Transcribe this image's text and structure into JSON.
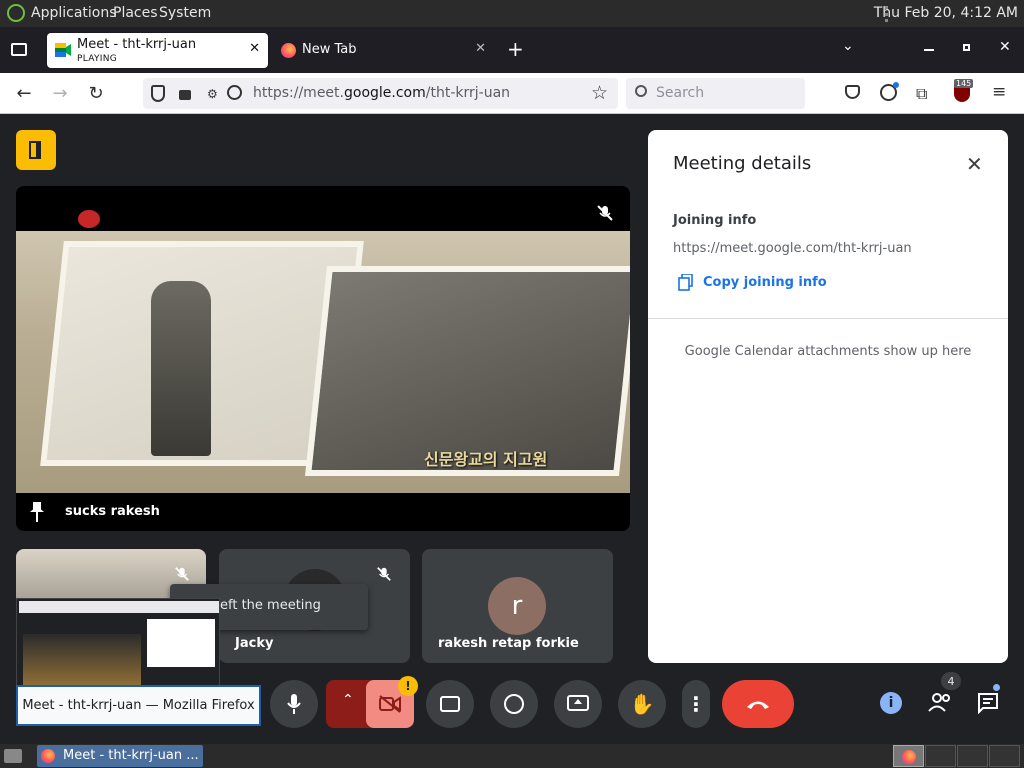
{
  "top_panel": {
    "applications": "Applications",
    "places": "Places",
    "system": "System",
    "clock": "Thu Feb 20,  4:12 AM"
  },
  "tabs": [
    {
      "title": "Meet - tht-krrj-uan",
      "subtitle": "PLAYING"
    },
    {
      "title": "New Tab"
    }
  ],
  "navbar": {
    "url_prefix": "https://meet.",
    "url_domain": "google.com",
    "url_path": "/tht-krrj-uan",
    "search_placeholder": "Search",
    "extension_badge": "145"
  },
  "main_tile": {
    "name": "sucks rakesh",
    "subtitle_overlay": "신문왕교의 지고원"
  },
  "tiles": [
    {
      "name": ""
    },
    {
      "name": "Jacky"
    },
    {
      "name": "rakesh retap forkie",
      "avatar_letter": "r",
      "avatar_color": "#8d6e63"
    }
  ],
  "left_notice": "eft the meeting",
  "details": {
    "title": "Meeting details",
    "joining_info_label": "Joining info",
    "joining_url": "https://meet.google.com/tht-krrj-uan",
    "copy_label": "Copy joining info",
    "calendar_note": "Google Calendar attachments show up here"
  },
  "controls": {
    "camera_warning": "!",
    "people_count": "4"
  },
  "tooltip": "Meet - tht-krrj-uan — Mozilla Firefox",
  "taskbar": {
    "window_title": "Meet - tht-krrj-uan ..."
  },
  "colors": {
    "accent_blue": "#1a73e8",
    "end_call_red": "#ea4335",
    "warning_yellow": "#fbbc04",
    "meet_yellow": "#fbbc04"
  }
}
